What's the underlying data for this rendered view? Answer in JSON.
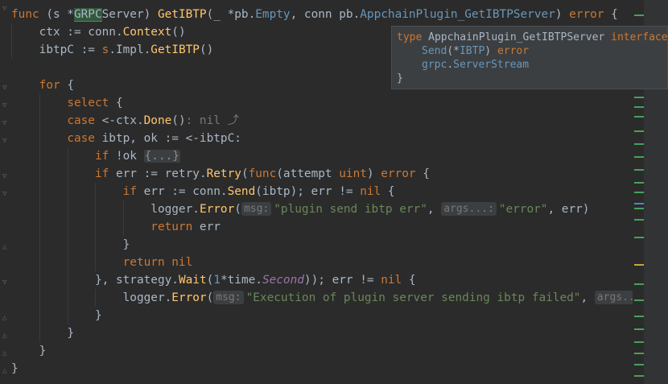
{
  "colors": {
    "background": "#2b2b2b",
    "keyword": "#cc7832",
    "function": "#ffc66d",
    "string": "#6a8759",
    "number": "#6897bb",
    "marker_green": "#49a05a",
    "marker_yellow": "#c9a53c",
    "marker_blue": "#4a88c7"
  },
  "code": {
    "l1": {
      "kw_func": "func",
      "recv_open": " (s *",
      "recv_type_hl": "GRPC",
      "recv_type_rest": "Server",
      "recv_close": ") ",
      "name": "GetIBTP",
      "p1": "(_ *",
      "p1_pkg": "pb",
      "p1_dot": ".",
      "p1_type": "Empty",
      "p2": ", conn ",
      "p2_pkg": "pb",
      "p2_dot": ".",
      "p2_type": "AppchainPlugin_GetIBTPServer",
      "p_close": ") ",
      "ret": "error",
      "brace": " {"
    },
    "l2": {
      "a": "ctx := conn.",
      "fn": "Context",
      "b": "()"
    },
    "l3": {
      "a": "ibtpC := ",
      "s": "s",
      "b": ".Impl.",
      "fn": "GetIBTP",
      "c": "()"
    },
    "l5": {
      "kw": "for",
      "b": " {"
    },
    "l6": {
      "kw": "select",
      "b": " {"
    },
    "l7": {
      "kw": "case",
      "a": " <-ctx.",
      "fn": "Done",
      "b": "()",
      "inlay": ": nil ⤴"
    },
    "l8": {
      "kw": "case",
      "a": " ibtp",
      "b": ", ok := <-ibtpC:"
    },
    "l9": {
      "kw": "if",
      "a": " !ok ",
      "fold": "{...}"
    },
    "l10": {
      "kw": "if",
      "a": " err := ",
      "pkg": "retry",
      "dot": ".",
      "fn": "Retry",
      "b": "(",
      "kw2": "func",
      "c": "(attempt ",
      "ty": "uint",
      "d": ") ",
      "ret": "error",
      "e": " {"
    },
    "l11": {
      "kw": "if",
      "a": " err := conn.",
      "fn": "Send",
      "b": "(ibtp); err != ",
      "nil": "nil",
      "c": " {"
    },
    "l12": {
      "a": "logger.",
      "fn": "Error",
      "b": "(",
      "hint1": "msg:",
      "str1": "\"plugin send ibtp err\"",
      "c": ", ",
      "hint2": "args...:",
      "str2": "\"error\"",
      "d": ", err)"
    },
    "l13": {
      "kw": "return",
      "a": " err"
    },
    "l14": {
      "a": "}"
    },
    "l15": {
      "kw": "return",
      "a": " nil"
    },
    "l16": {
      "a": "}, ",
      "pkg": "strategy",
      "dot": ".",
      "fn": "Wait",
      "b": "(",
      "num": "1",
      "c": "*time.",
      "it": "Second",
      "d": ")); err != ",
      "nil": "nil",
      "e": " {"
    },
    "l17": {
      "a": "logger.",
      "fn": "Error",
      "b": "(",
      "hint1": "msg:",
      "str1": "\"Execution of plugin server sending ibtp failed\"",
      "c": ", ",
      "hint2": "args..."
    },
    "l18": {
      "a": "}"
    },
    "l19": {
      "a": "}"
    },
    "l20": {
      "a": "}"
    },
    "l21": {
      "a": "}"
    }
  },
  "popup": {
    "kw_type": "type",
    "type_name": "AppchainPlugin_GetIBTPServer",
    "kw_interface": "interface",
    "brace_open": "{",
    "m1_name": "Send",
    "m1_sig_a": "(*",
    "m1_sig_type": "IBTP",
    "m1_sig_b": ") ",
    "m1_ret": "error",
    "m2_pkg": "grpc",
    "m2_dot": ".",
    "m2_type": "ServerStream",
    "brace_close": "}"
  }
}
